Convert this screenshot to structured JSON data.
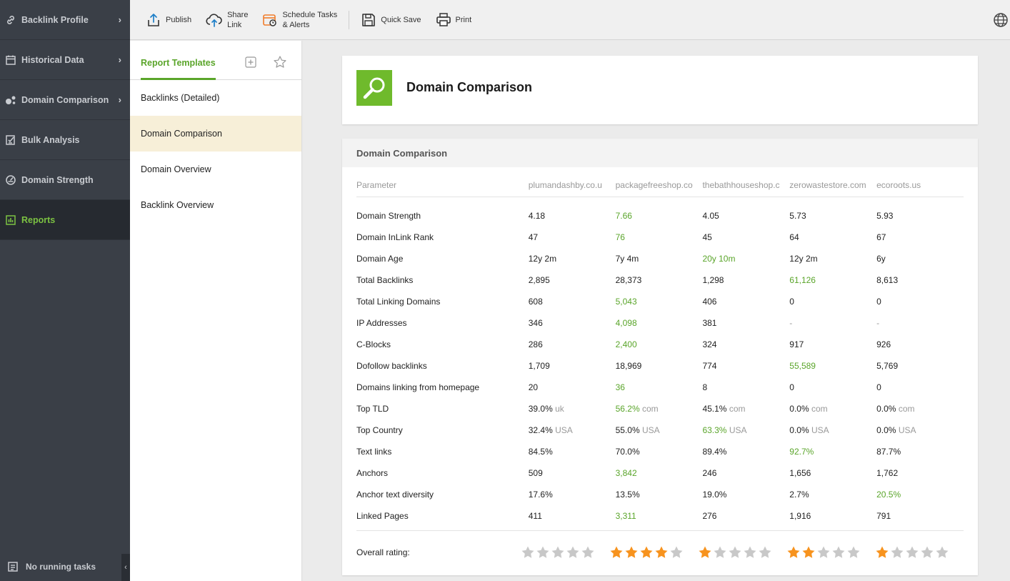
{
  "sidebar": {
    "items": [
      {
        "label": "Backlink Profile",
        "icon": "link-icon",
        "chevron": "›"
      },
      {
        "label": "Historical Data",
        "icon": "calendar-icon",
        "chevron": "›"
      },
      {
        "label": "Domain Comparison",
        "icon": "bubbles-icon",
        "chevron": "›"
      },
      {
        "label": "Bulk Analysis",
        "icon": "checklist-icon",
        "chevron": ""
      },
      {
        "label": "Domain Strength",
        "icon": "gauge-icon",
        "chevron": ""
      },
      {
        "label": "Reports",
        "icon": "report-icon",
        "chevron": ""
      }
    ],
    "footer_label": "No running tasks",
    "collapse_glyph": "‹"
  },
  "toolbar": {
    "publish": "Publish",
    "share_line1": "Share",
    "share_line2": "Link",
    "schedule_line1": "Schedule Tasks",
    "schedule_line2": "& Alerts",
    "quick_save": "Quick Save",
    "print": "Print"
  },
  "templates": {
    "tab_label": "Report Templates",
    "items": [
      "Backlinks (Detailed)",
      "Domain Comparison",
      "Domain Overview",
      "Backlink Overview"
    ],
    "selected_index": 1
  },
  "report": {
    "title": "Domain Comparison",
    "section_title": "Domain Comparison",
    "parameter_header": "Parameter",
    "domains": [
      "plumandashby.co.u",
      "packagefreeshop.co",
      "thebathhouseshop.c",
      "zerowastestore.com",
      "ecoroots.us"
    ],
    "rows": [
      {
        "param": "Domain Strength",
        "values": [
          {
            "v": "4.18"
          },
          {
            "v": "7.66",
            "best": true
          },
          {
            "v": "4.05"
          },
          {
            "v": "5.73"
          },
          {
            "v": "5.93"
          }
        ]
      },
      {
        "param": "Domain InLink Rank",
        "values": [
          {
            "v": "47"
          },
          {
            "v": "76",
            "best": true
          },
          {
            "v": "45"
          },
          {
            "v": "64"
          },
          {
            "v": "67"
          }
        ]
      },
      {
        "param": "Domain Age",
        "values": [
          {
            "v": "12y 2m"
          },
          {
            "v": "7y 4m"
          },
          {
            "v": "20y 10m",
            "best": true
          },
          {
            "v": "12y 2m"
          },
          {
            "v": "6y"
          }
        ]
      },
      {
        "param": "Total Backlinks",
        "values": [
          {
            "v": "2,895"
          },
          {
            "v": "28,373"
          },
          {
            "v": "1,298"
          },
          {
            "v": "61,126",
            "best": true
          },
          {
            "v": "8,613"
          }
        ]
      },
      {
        "param": "Total Linking Domains",
        "values": [
          {
            "v": "608"
          },
          {
            "v": "5,043",
            "best": true
          },
          {
            "v": "406"
          },
          {
            "v": "0"
          },
          {
            "v": "0"
          }
        ]
      },
      {
        "param": "IP Addresses",
        "values": [
          {
            "v": "346"
          },
          {
            "v": "4,098",
            "best": true
          },
          {
            "v": "381"
          },
          {
            "v": "-",
            "muted": true
          },
          {
            "v": "-",
            "muted": true
          }
        ]
      },
      {
        "param": "C-Blocks",
        "values": [
          {
            "v": "286"
          },
          {
            "v": "2,400",
            "best": true
          },
          {
            "v": "324"
          },
          {
            "v": "917"
          },
          {
            "v": "926"
          }
        ]
      },
      {
        "param": "Dofollow backlinks",
        "values": [
          {
            "v": "1,709"
          },
          {
            "v": "18,969"
          },
          {
            "v": "774"
          },
          {
            "v": "55,589",
            "best": true
          },
          {
            "v": "5,769"
          }
        ]
      },
      {
        "param": "Domains linking from homepage",
        "values": [
          {
            "v": "20"
          },
          {
            "v": "36",
            "best": true
          },
          {
            "v": "8"
          },
          {
            "v": "0"
          },
          {
            "v": "0"
          }
        ]
      },
      {
        "param": "Top TLD",
        "values": [
          {
            "v": "39.0%",
            "s": "uk"
          },
          {
            "v": "56.2%",
            "s": "com",
            "best": true
          },
          {
            "v": "45.1%",
            "s": "com"
          },
          {
            "v": "0.0%",
            "s": "com"
          },
          {
            "v": "0.0%",
            "s": "com"
          }
        ]
      },
      {
        "param": "Top Country",
        "values": [
          {
            "v": "32.4%",
            "s": "USA"
          },
          {
            "v": "55.0%",
            "s": "USA"
          },
          {
            "v": "63.3%",
            "s": "USA",
            "best": true
          },
          {
            "v": "0.0%",
            "s": "USA"
          },
          {
            "v": "0.0%",
            "s": "USA"
          }
        ]
      },
      {
        "param": "Text links",
        "values": [
          {
            "v": "84.5%"
          },
          {
            "v": "70.0%"
          },
          {
            "v": "89.4%"
          },
          {
            "v": "92.7%",
            "best": true
          },
          {
            "v": "87.7%"
          }
        ]
      },
      {
        "param": "Anchors",
        "values": [
          {
            "v": "509"
          },
          {
            "v": "3,842",
            "best": true
          },
          {
            "v": "246"
          },
          {
            "v": "1,656"
          },
          {
            "v": "1,762"
          }
        ]
      },
      {
        "param": "Anchor text diversity",
        "values": [
          {
            "v": "17.6%"
          },
          {
            "v": "13.5%"
          },
          {
            "v": "19.0%"
          },
          {
            "v": "2.7%"
          },
          {
            "v": "20.5%",
            "best": true
          }
        ]
      },
      {
        "param": "Linked Pages",
        "values": [
          {
            "v": "411"
          },
          {
            "v": "3,311",
            "best": true
          },
          {
            "v": "276"
          },
          {
            "v": "1,916"
          },
          {
            "v": "791"
          }
        ]
      }
    ],
    "rating_label": "Overall rating:",
    "ratings": [
      0,
      4,
      1,
      2,
      1
    ],
    "rating_max": 5
  },
  "colors": {
    "accent_green": "#5aa52a",
    "star_filled": "#f7931e",
    "star_empty": "#c8c8c8",
    "sidebar_bg": "#3a3f47"
  }
}
